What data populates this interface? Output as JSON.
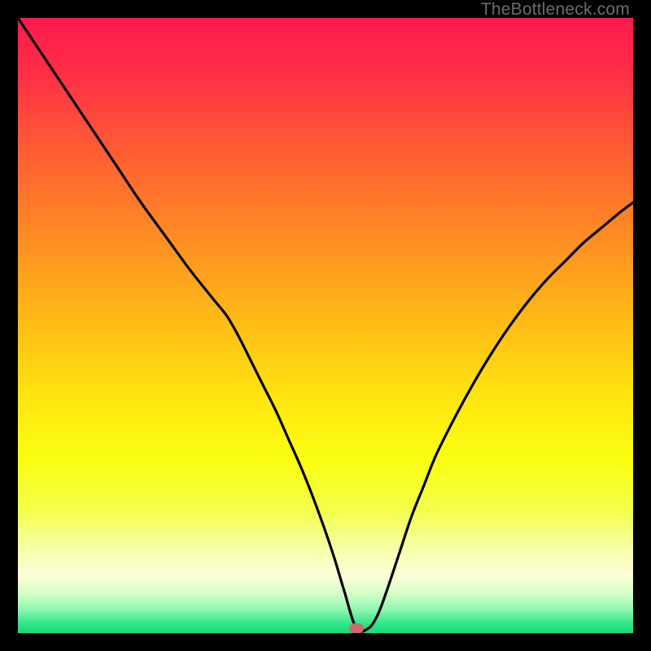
{
  "watermark": "TheBottleneck.com",
  "marker": {
    "x_pct": 55.0,
    "y_pct": 0.0,
    "color": "#cc6a6f"
  },
  "gradient": {
    "stops": [
      {
        "offset": 0,
        "color": "#ff1a4d"
      },
      {
        "offset": 0.08,
        "color": "#ff2b47"
      },
      {
        "offset": 0.2,
        "color": "#ff5736"
      },
      {
        "offset": 0.35,
        "color": "#ff8a24"
      },
      {
        "offset": 0.5,
        "color": "#ffbd15"
      },
      {
        "offset": 0.62,
        "color": "#ffe60f"
      },
      {
        "offset": 0.72,
        "color": "#faff12"
      },
      {
        "offset": 0.8,
        "color": "#f3ff4a"
      },
      {
        "offset": 0.86,
        "color": "#f7ffa5"
      },
      {
        "offset": 0.905,
        "color": "#fbffd8"
      },
      {
        "offset": 0.935,
        "color": "#d6ffc8"
      },
      {
        "offset": 0.962,
        "color": "#8cf7b0"
      },
      {
        "offset": 0.985,
        "color": "#30e589"
      },
      {
        "offset": 1.0,
        "color": "#19d975"
      }
    ]
  },
  "chart_data": {
    "type": "line",
    "title": "",
    "xlabel": "",
    "ylabel": "",
    "xlim": [
      0,
      100
    ],
    "ylim": [
      0,
      100
    ],
    "series": [
      {
        "name": "bottleneck-curve",
        "x": [
          0,
          4,
          8,
          12,
          16,
          20,
          24,
          28,
          32,
          34,
          36,
          38,
          40,
          42,
          44,
          46,
          48,
          50,
          51.5,
          53,
          55,
          57,
          58.5,
          60,
          62,
          64,
          66,
          68,
          71,
          74,
          77,
          80,
          83,
          86,
          89,
          92,
          95,
          98,
          100
        ],
        "y": [
          100,
          94,
          88,
          82,
          76,
          70,
          64.5,
          59,
          54,
          51.5,
          48,
          44,
          40,
          36,
          31.5,
          27,
          22,
          16.5,
          12,
          7,
          0.8,
          0.8,
          3,
          7,
          13,
          19,
          24,
          29,
          35,
          40.5,
          45.5,
          50,
          54,
          57.5,
          60.5,
          63.5,
          66,
          68.5,
          70
        ]
      }
    ],
    "marker_point": {
      "x": 55,
      "y": 0.8
    }
  }
}
